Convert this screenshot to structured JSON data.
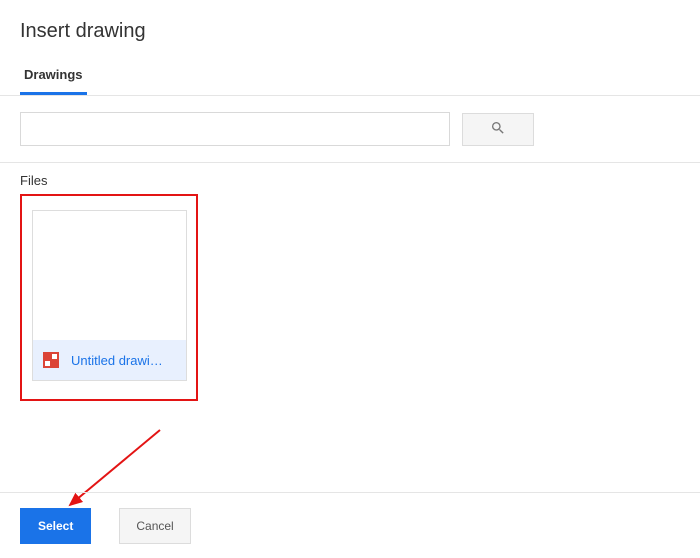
{
  "dialog": {
    "title": "Insert drawing"
  },
  "tabs": {
    "active": "Drawings"
  },
  "search": {
    "value": "",
    "placeholder": ""
  },
  "files": {
    "section_label": "Files",
    "items": [
      {
        "name": "Untitled drawi…",
        "icon": "drawing-icon"
      }
    ]
  },
  "footer": {
    "select_label": "Select",
    "cancel_label": "Cancel"
  }
}
